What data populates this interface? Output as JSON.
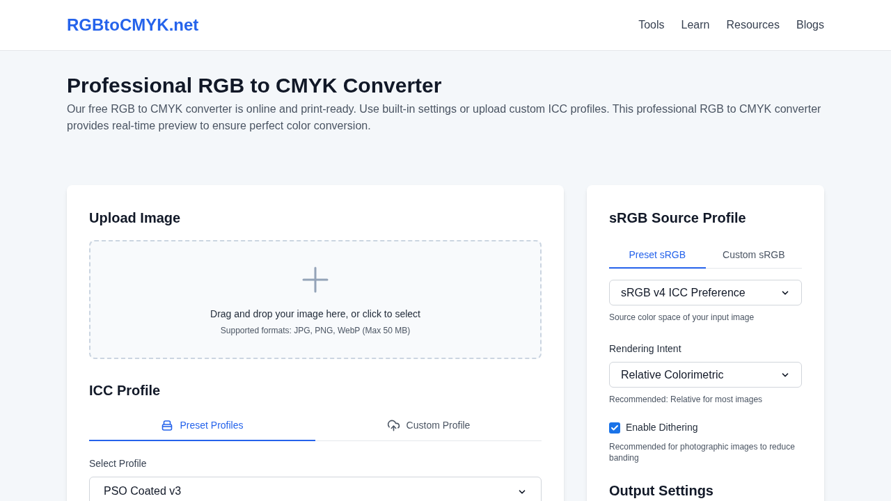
{
  "header": {
    "logo": "RGBtoCMYK.net",
    "nav": [
      "Tools",
      "Learn",
      "Resources",
      "Blogs"
    ]
  },
  "hero": {
    "title": "Professional RGB to CMYK Converter",
    "description": "Our free RGB to CMYK converter is online and print-ready. Use built-in settings or upload custom ICC profiles. This professional RGB to CMYK converter provides real-time preview to ensure perfect color conversion."
  },
  "upload": {
    "title": "Upload Image",
    "prompt": "Drag and drop your image here, or click to select",
    "formats": "Supported formats: JPG, PNG, WebP (Max 50 MB)"
  },
  "icc": {
    "title": "ICC Profile",
    "tabs": [
      {
        "label": "Preset Profiles",
        "selected": true
      },
      {
        "label": "Custom Profile",
        "selected": false
      }
    ],
    "select_label": "Select Profile",
    "select_value": "PSO Coated v3"
  },
  "source": {
    "title": "sRGB Source Profile",
    "tabs": [
      {
        "label": "Preset sRGB",
        "selected": true
      },
      {
        "label": "Custom sRGB",
        "selected": false
      }
    ],
    "profile_value": "sRGB v4 ICC Preference",
    "profile_hint": "Source color space of your input image",
    "intent_label": "Rendering Intent",
    "intent_value": "Relative Colorimetric",
    "intent_hint": "Recommended: Relative for most images",
    "dithering": {
      "label": "Enable Dithering",
      "checked": true
    },
    "dithering_hint": "Recommended for photographic images to reduce banding",
    "output_title": "Output Settings"
  }
}
